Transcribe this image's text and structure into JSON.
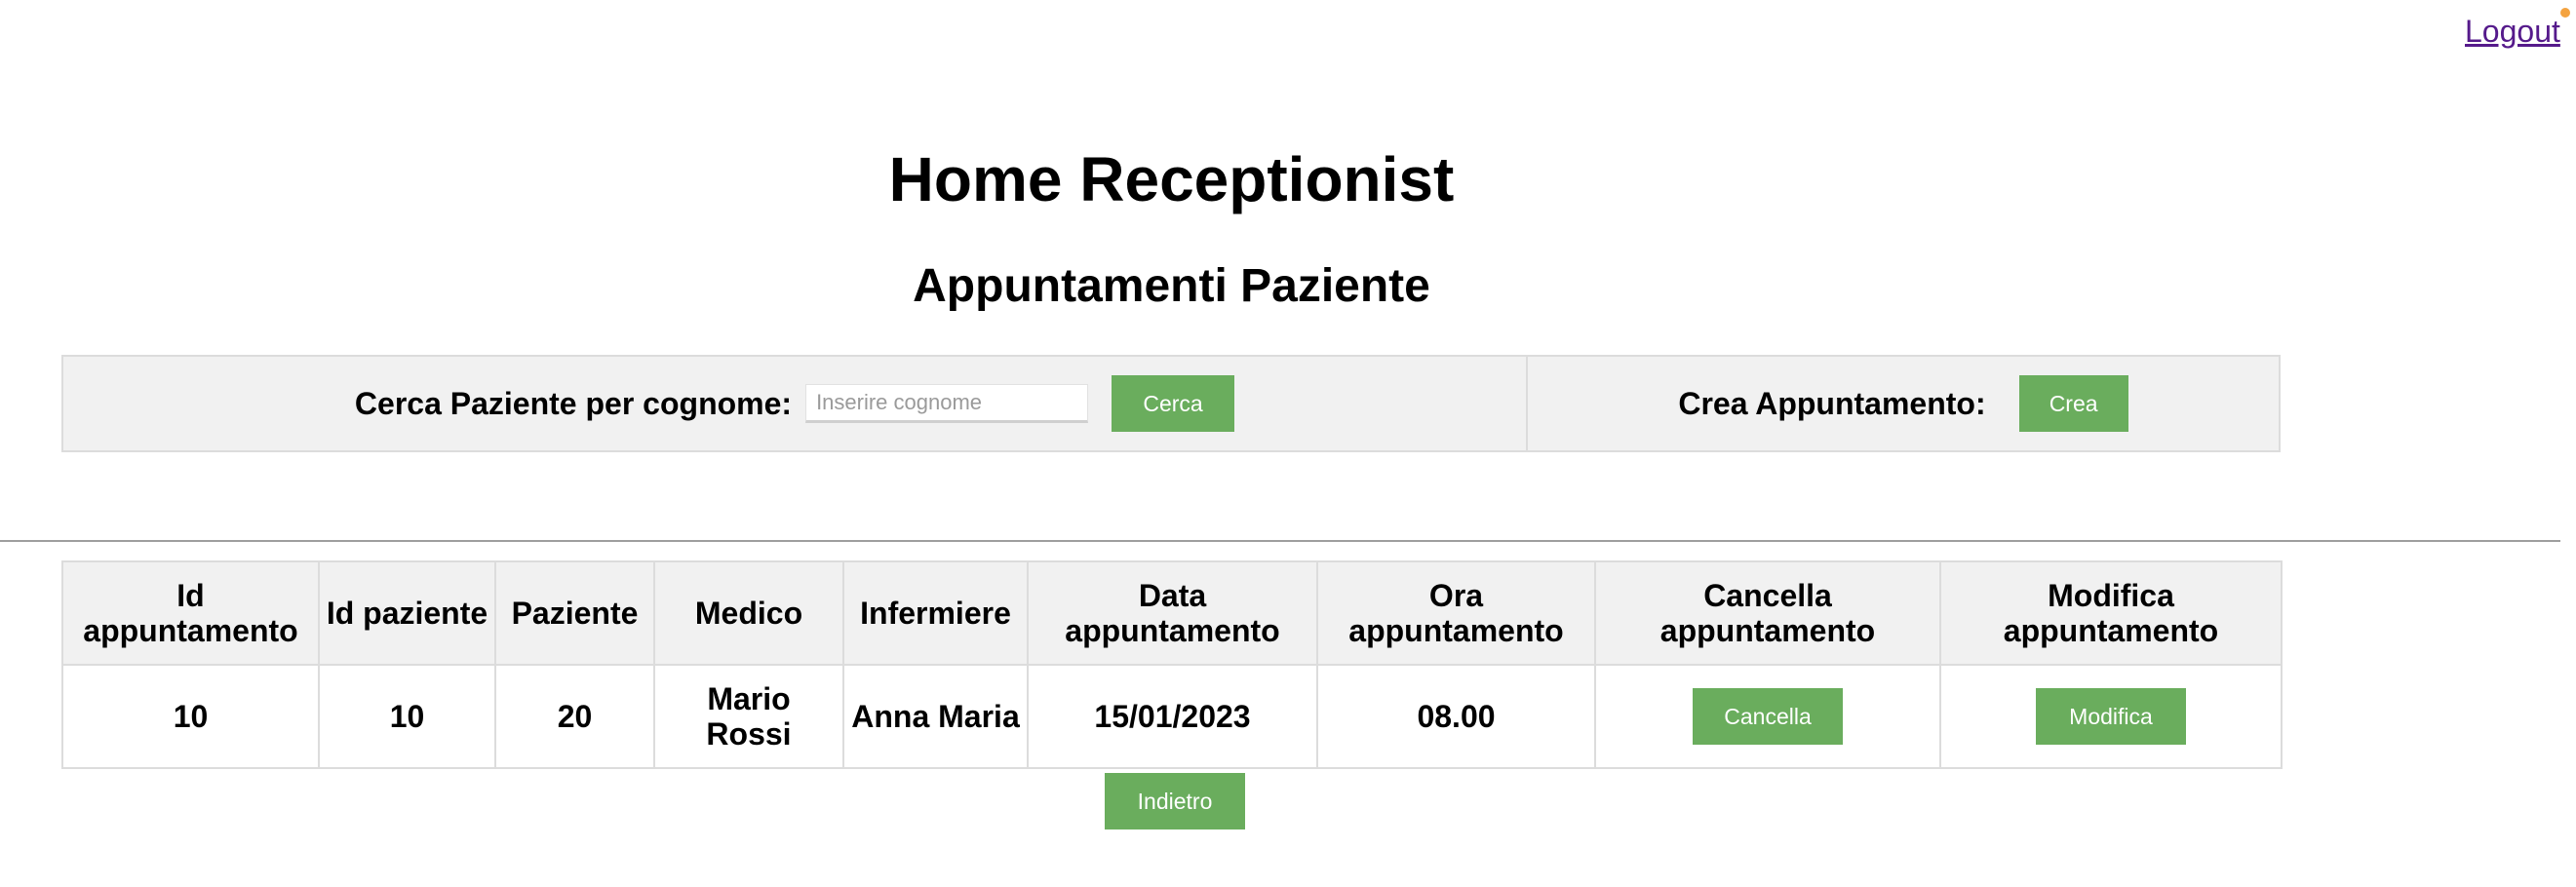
{
  "header": {
    "logout_label": "Logout"
  },
  "page": {
    "title": "Home Receptionist",
    "subtitle": "Appuntamenti Paziente"
  },
  "toolbar": {
    "search_label": "Cerca Paziente per cognome:",
    "search_placeholder": "Inserire cognome",
    "search_value": "",
    "search_button": "Cerca",
    "create_label": "Crea Appuntamento:",
    "create_button": "Crea"
  },
  "table": {
    "columns": [
      "Id appuntamento",
      "Id paziente",
      "Paziente",
      "Medico",
      "Infermiere",
      "Data appuntamento",
      "Ora appuntamento",
      "Cancella appuntamento",
      "Modifica appuntamento"
    ],
    "rows": [
      {
        "id_appuntamento": "10",
        "id_paziente": "10",
        "paziente": "20",
        "medico": "Mario Rossi",
        "infermiere": "Anna Maria",
        "data": "15/01/2023",
        "ora": "08.00",
        "cancella_label": "Cancella",
        "modifica_label": "Modifica"
      }
    ]
  },
  "footer": {
    "back_button": "Indietro"
  },
  "colors": {
    "button_green": "#6aad5d",
    "panel_gray": "#f1f1f1",
    "link_visited": "#551A8B",
    "notification_dot": "#f4a340"
  }
}
